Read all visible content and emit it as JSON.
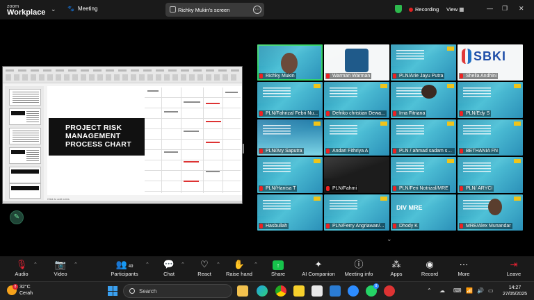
{
  "app": {
    "brand_small": "zoom",
    "brand_large": "Workplace",
    "meeting_label": "Meeting"
  },
  "share": {
    "label": "Richky Mukin's screen"
  },
  "status": {
    "recording": "Recording",
    "view": "View"
  },
  "slide": {
    "title_line1": "PROJECT RISK",
    "title_line2": "MANAGEMENT",
    "title_line3": "PROCESS CHART",
    "notes_placeholder": "Click to add notes"
  },
  "participants": [
    {
      "name": "Richky Mukin",
      "style": "active"
    },
    {
      "name": "Warman Warman",
      "style": "white"
    },
    {
      "name": "PLN/Arie Jayu Putra",
      "style": "blue"
    },
    {
      "name": "Shella Andhini",
      "style": "sbki"
    },
    {
      "name": "PLN/Fahrizal Febri Nu...",
      "style": "blue"
    },
    {
      "name": "Defriko christian Dewa...",
      "style": "blue"
    },
    {
      "name": "Irna Fitriana",
      "style": "blue"
    },
    {
      "name": "PLN/Edy S",
      "style": "blue"
    },
    {
      "name": "PLN/Ary Saputra",
      "style": "sky"
    },
    {
      "name": "Andari Fithriya A",
      "style": "blue"
    },
    {
      "name": "PLN / ahmad sadam sy...",
      "style": "blue"
    },
    {
      "name": "BETHANIA FN",
      "style": "blue"
    },
    {
      "name": "PLN/Hanisa T",
      "style": "blue"
    },
    {
      "name": "PLN/Fahmi",
      "style": "dark"
    },
    {
      "name": "PLN/Feri Notrizal/MRE",
      "style": "blue"
    },
    {
      "name": "PLN/ ARYCI",
      "style": "blue"
    },
    {
      "name": "Hasbullah",
      "style": "blue"
    },
    {
      "name": "PLN/Ferry Angriawan/...",
      "style": "blue"
    },
    {
      "name": "Dhody K",
      "style": "divmre"
    },
    {
      "name": "MRE/Alex Munandar",
      "style": "blue"
    }
  ],
  "divmre_tile": {
    "text": "DIV MRE"
  },
  "sbki_tile": {
    "text": "SBKI"
  },
  "toolbar": {
    "audio": "Audio",
    "video": "Video",
    "participants": "Participants",
    "participants_count": "49",
    "chat": "Chat",
    "react": "React",
    "raise_hand": "Raise hand",
    "share": "Share",
    "ai_companion": "AI Companion",
    "meeting_info": "Meeting info",
    "apps": "Apps",
    "record": "Record",
    "more": "More",
    "leave": "Leave"
  },
  "taskbar": {
    "temp": "32°C",
    "condition": "Cerah",
    "weather_badge": "8",
    "search_placeholder": "Search",
    "time": "14:27",
    "date": "27/05/2025",
    "whatsapp_badge": "8"
  },
  "colors": {
    "accent_green": "#16c34b",
    "record_red": "#e02020",
    "tile_blue": "#2b90b8"
  }
}
